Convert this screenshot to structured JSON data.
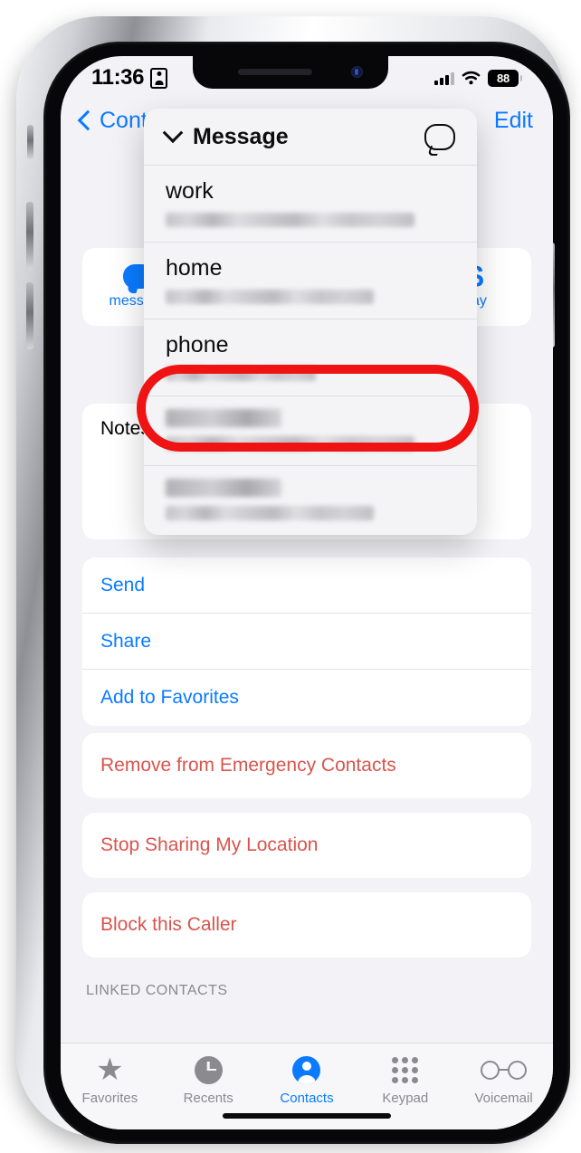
{
  "status_bar": {
    "time": "11:36",
    "contact_card_icon": "contact-card-icon",
    "signal_icon": "cellular-signal-icon",
    "wifi_icon": "wifi-icon",
    "battery_level": "88"
  },
  "nav_bar": {
    "back_label": "Cont",
    "back_icon": "chevron-left-icon",
    "edit_label": "Edit"
  },
  "contact": {
    "avatar_color": "#9b8ed4",
    "quick_actions": [
      {
        "label": "message",
        "icon": "message-bubble-icon"
      },
      {
        "label": "pay",
        "icon": "dollar-sign-icon"
      }
    ],
    "notes_label": "Notes",
    "link_rows": [
      {
        "label": "Send"
      },
      {
        "label": "Share"
      },
      {
        "label": "Add to Favorites"
      }
    ],
    "danger_rows": [
      {
        "label": "Remove from Emergency Contacts"
      },
      {
        "label": "Stop Sharing My Location"
      },
      {
        "label": "Block this Caller"
      }
    ],
    "linked_contacts_header": "LINKED CONTACTS"
  },
  "popup": {
    "title": "Message",
    "chevron_icon": "chevron-down-icon",
    "bubble_icon": "message-bubble-outline-icon",
    "rows": [
      {
        "label": "work",
        "value": "",
        "redacted": true
      },
      {
        "label": "home",
        "value": "",
        "redacted": true
      },
      {
        "label": "phone",
        "value": "",
        "redacted": true,
        "highlighted": true
      },
      {
        "label": "",
        "value": "",
        "redacted": true,
        "label_redacted": true
      },
      {
        "label": "",
        "value": "",
        "redacted": true,
        "label_redacted": true
      }
    ]
  },
  "annotation": {
    "shape": "oval",
    "color": "#ef1313",
    "targets": "phone"
  },
  "tab_bar": {
    "active": "Contacts",
    "tabs": [
      {
        "label": "Favorites",
        "icon": "star-icon"
      },
      {
        "label": "Recents",
        "icon": "clock-icon"
      },
      {
        "label": "Contacts",
        "icon": "person-circle-icon"
      },
      {
        "label": "Keypad",
        "icon": "keypad-grid-icon"
      },
      {
        "label": "Voicemail",
        "icon": "voicemail-icon"
      }
    ]
  }
}
